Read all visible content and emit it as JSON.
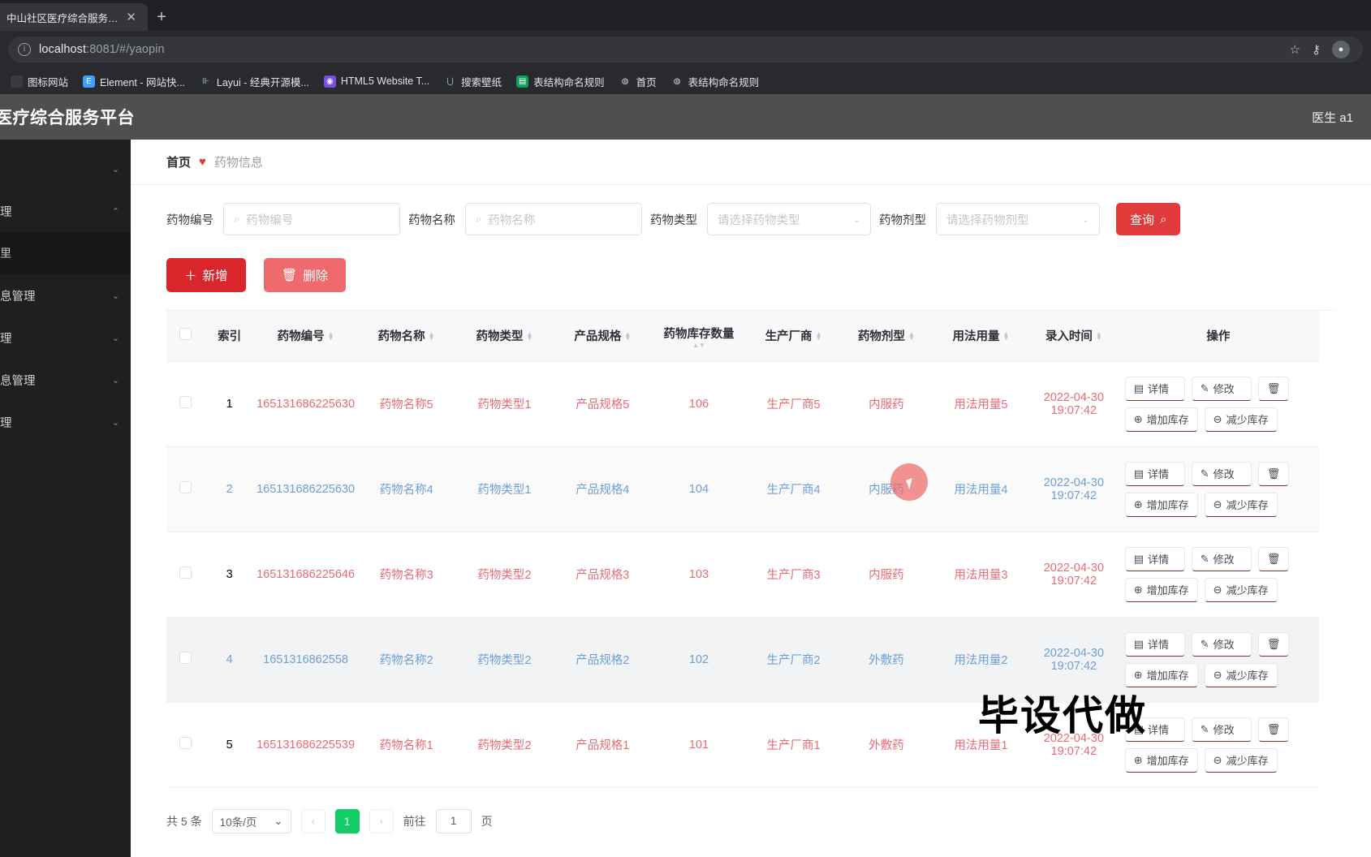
{
  "browser": {
    "tab_title": "中山社区医疗综合服务平台",
    "tab_close": "✕",
    "new_tab": "+",
    "url_scheme_host": "localhost",
    "url_rest": ":8081/#/yaopin",
    "star_icon": "☆",
    "key_icon": "⚷",
    "profile_initial": "●",
    "bookmarks": [
      {
        "label": "图标网站",
        "icon_color": "#3a3b3f",
        "glyph": ""
      },
      {
        "label": "Element - 网站快...",
        "icon_color": "#409eff",
        "glyph": "E"
      },
      {
        "label": "Layui - 经典开源模...",
        "icon_color": "#2b2c30",
        "glyph": "⏸"
      },
      {
        "label": "HTML5 Website T...",
        "icon_color": "#7a4ee0",
        "glyph": "◉"
      },
      {
        "label": "搜索壁纸",
        "icon_color": "#2b2c30",
        "glyph": "⋃"
      },
      {
        "label": "表结构命名规则",
        "icon_color": "#0f9d58",
        "glyph": "▤"
      },
      {
        "label": "首页",
        "icon_color": "#2b2c30",
        "glyph": "🌐"
      },
      {
        "label": "表结构命名规则",
        "icon_color": "#2b2c30",
        "glyph": "🌐"
      }
    ]
  },
  "app": {
    "title": "医疗综合服务平台",
    "user": "医生 a1"
  },
  "sidebar": {
    "items": [
      {
        "label": "",
        "chevron": "⌄",
        "sub": false
      },
      {
        "label": "理",
        "chevron": "⌃",
        "sub": false
      },
      {
        "label": "里",
        "chevron": "",
        "sub": true
      },
      {
        "label": "息管理",
        "chevron": "⌄",
        "sub": false
      },
      {
        "label": "理",
        "chevron": "⌄",
        "sub": false
      },
      {
        "label": "息管理",
        "chevron": "⌄",
        "sub": false
      },
      {
        "label": "理",
        "chevron": "⌄",
        "sub": false
      }
    ]
  },
  "breadcrumb": {
    "home": "首页",
    "heart": "♥",
    "current": "药物信息"
  },
  "search": {
    "code_label": "药物编号",
    "code_placeholder": "药物编号",
    "name_label": "药物名称",
    "name_placeholder": "药物名称",
    "type_label": "药物类型",
    "type_placeholder": "请选择药物类型",
    "dosage_label": "药物剂型",
    "dosage_placeholder": "请选择药物剂型",
    "search_button": "查询",
    "search_icon": "🔍",
    "magnifier": "🔍",
    "chevron": "⌄"
  },
  "actions": {
    "add_label": "新增",
    "add_icon": "＋",
    "delete_label": "删除",
    "delete_icon": "🗑"
  },
  "table": {
    "columns": [
      {
        "label": "索引",
        "sortable": false
      },
      {
        "label": "药物编号",
        "sortable": true
      },
      {
        "label": "药物名称",
        "sortable": true
      },
      {
        "label": "药物类型",
        "sortable": true
      },
      {
        "label": "产品规格",
        "sortable": true
      },
      {
        "label": "药物库存数量",
        "sortable": true
      },
      {
        "label": "生产厂商",
        "sortable": true
      },
      {
        "label": "药物剂型",
        "sortable": true
      },
      {
        "label": "用法用量",
        "sortable": true
      },
      {
        "label": "录入时间",
        "sortable": true
      },
      {
        "label": "操作",
        "sortable": false
      }
    ],
    "rows": [
      {
        "index": "1",
        "code": "165131686225630",
        "name": "药物名称5",
        "type": "药物类型1",
        "spec": "产品规格5",
        "stock": "106",
        "maker": "生产厂商5",
        "dosage": "内服药",
        "usage": "用法用量5",
        "time": "2022-04-30 19:07:42"
      },
      {
        "index": "2",
        "code": "165131686225630",
        "name": "药物名称4",
        "type": "药物类型1",
        "spec": "产品规格4",
        "stock": "104",
        "maker": "生产厂商4",
        "dosage": "内服药",
        "usage": "用法用量4",
        "time": "2022-04-30 19:07:42"
      },
      {
        "index": "3",
        "code": "165131686225646",
        "name": "药物名称3",
        "type": "药物类型2",
        "spec": "产品规格3",
        "stock": "103",
        "maker": "生产厂商3",
        "dosage": "内服药",
        "usage": "用法用量3",
        "time": "2022-04-30 19:07:42"
      },
      {
        "index": "4",
        "code": "1651316862558",
        "name": "药物名称2",
        "type": "药物类型2",
        "spec": "产品规格2",
        "stock": "102",
        "maker": "生产厂商2",
        "dosage": "外敷药",
        "usage": "用法用量2",
        "time": "2022-04-30 19:07:42"
      },
      {
        "index": "5",
        "code": "165131686225539",
        "name": "药物名称1",
        "type": "药物类型2",
        "spec": "产品规格1",
        "stock": "101",
        "maker": "生产厂商1",
        "dosage": "外敷药",
        "usage": "用法用量1",
        "time": "2022-04-30 19:07:42"
      }
    ],
    "row_ops": [
      {
        "label": "详情",
        "icon": "▤"
      },
      {
        "label": "修改",
        "icon": "✎"
      },
      {
        "label": "",
        "icon": "🗑"
      },
      {
        "label": "增加库存",
        "icon": "⊕"
      },
      {
        "label": "减少库存",
        "icon": "⊖"
      }
    ]
  },
  "pagination": {
    "total_text": "共 5 条",
    "page_size": "10条/页",
    "prev_icon": "‹",
    "next_icon": "›",
    "current_page": "1",
    "goto_label": "前往",
    "goto_value": "1",
    "page_unit": "页"
  },
  "overlay": {
    "watermark": "毕设代做"
  },
  "colors": {
    "accent_red": "#e03a3a",
    "add_red": "#d9262b",
    "delete_red": "#ee6a6c",
    "page_green": "#13ce66",
    "header_gray": "#4f4f52",
    "sidebar_dark": "#1f1f22"
  }
}
